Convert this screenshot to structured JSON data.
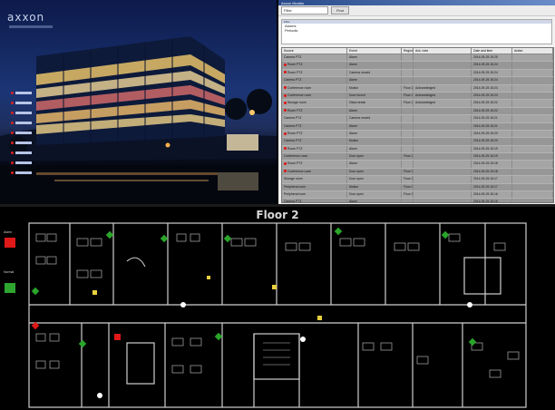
{
  "photo": {
    "logo_text": "axxon",
    "floors": [
      "Floor 1",
      "Floor 2",
      "Floor 3",
      "Floor 4",
      "Floor 5",
      "Floor 6",
      "Floor 7",
      "Floor 8",
      "Floor 9"
    ]
  },
  "window": {
    "title": "Axxon Monitor",
    "search_value": "Filter",
    "apply_label": "Find",
    "filter_header": "Filter",
    "filter_lines": [
      "Alarms",
      "Periodic"
    ],
    "columns": [
      "Source",
      "Event",
      "Region",
      "Ack. note",
      "Date and time",
      "Action"
    ],
    "rows": [
      {
        "source": "Camera PTZ",
        "event": "Alarm",
        "region": "",
        "note": "",
        "time": "2014-09-25 15:25",
        "alarm": false
      },
      {
        "source": "Room PTZ",
        "event": "Alarm",
        "region": "",
        "note": "",
        "time": "2014-09-25 15:24",
        "alarm": true
      },
      {
        "source": "Room PTZ",
        "event": "Camera moved",
        "region": "",
        "note": "",
        "time": "2014-09-25 15:24",
        "alarm": true
      },
      {
        "source": "Camera PTZ",
        "event": "Alarm",
        "region": "",
        "note": "",
        "time": "2014-09-25 15:24",
        "alarm": false
      },
      {
        "source": "Conference room",
        "event": "Motion",
        "region": "Floor 2",
        "note": "Acknowledged",
        "time": "2014-09-25 15:23",
        "alarm": true
      },
      {
        "source": "Conference room",
        "event": "Door forced",
        "region": "Floor 2",
        "note": "Acknowledged",
        "time": "2014-09-25 15:23",
        "alarm": true
      },
      {
        "source": "Storage room",
        "event": "Glass break",
        "region": "Floor 2",
        "note": "Acknowledged",
        "time": "2014-09-25 15:22",
        "alarm": true
      },
      {
        "source": "Room PTZ",
        "event": "Alarm",
        "region": "",
        "note": "",
        "time": "2014-09-25 15:22",
        "alarm": true
      },
      {
        "source": "Camera PTZ",
        "event": "Camera moved",
        "region": "",
        "note": "",
        "time": "2014-09-25 15:21",
        "alarm": false
      },
      {
        "source": "Camera PTZ",
        "event": "Alarm",
        "region": "",
        "note": "",
        "time": "2014-09-25 15:21",
        "alarm": false
      },
      {
        "source": "Room PTZ",
        "event": "Alarm",
        "region": "",
        "note": "",
        "time": "2014-09-25 15:20",
        "alarm": true
      },
      {
        "source": "Camera PTZ",
        "event": "Motion",
        "region": "",
        "note": "",
        "time": "2014-09-25 15:20",
        "alarm": false
      },
      {
        "source": "Room PTZ",
        "event": "Alarm",
        "region": "",
        "note": "",
        "time": "2014-09-25 15:19",
        "alarm": true
      },
      {
        "source": "Conference room",
        "event": "Door open",
        "region": "Floor 2",
        "note": "",
        "time": "2014-09-25 15:19",
        "alarm": false
      },
      {
        "source": "Room PTZ",
        "event": "Alarm",
        "region": "",
        "note": "",
        "time": "2014-09-25 15:18",
        "alarm": true
      },
      {
        "source": "Conference room",
        "event": "Door open",
        "region": "Floor 2",
        "note": "",
        "time": "2014-09-25 15:18",
        "alarm": true
      },
      {
        "source": "Storage room",
        "event": "Door open",
        "region": "Floor 2",
        "note": "",
        "time": "2014-09-25 15:17",
        "alarm": false
      },
      {
        "source": "Peripheral room",
        "event": "Motion",
        "region": "Floor 2",
        "note": "",
        "time": "2014-09-25 15:17",
        "alarm": false
      },
      {
        "source": "Peripheral room",
        "event": "Door open",
        "region": "Floor 2",
        "note": "",
        "time": "2014-09-25 15:16",
        "alarm": false
      },
      {
        "source": "Camera PTZ",
        "event": "Alarm",
        "region": "",
        "note": "",
        "time": "2014-09-25 15:16",
        "alarm": false
      },
      {
        "source": "Storage room",
        "event": "Alert",
        "region": "Floor 2",
        "note": "",
        "time": "2014-09-25 15:15",
        "alarm": true
      }
    ]
  },
  "plan": {
    "title": "Floor 2",
    "legend": [
      {
        "label": "Alarm",
        "color": "#e01818"
      },
      {
        "label": "Normal",
        "color": "#2ea52e"
      }
    ]
  },
  "colors": {
    "alarm": "#d11111",
    "ok": "#2aa52a",
    "walls": "#cfcfcf"
  }
}
